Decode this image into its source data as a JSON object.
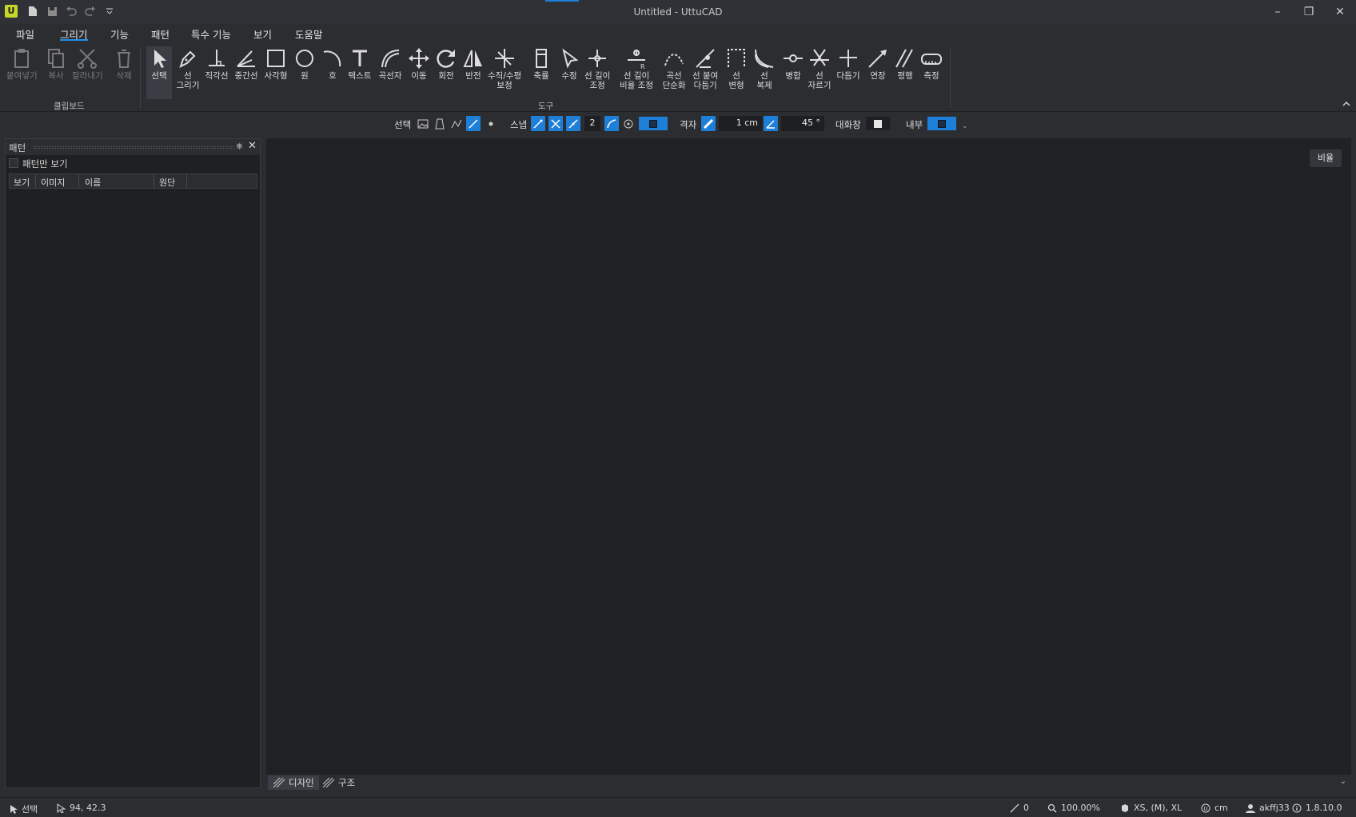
{
  "titlebar": {
    "title": "Untitled - UttuCAD",
    "logo": "U"
  },
  "menu": {
    "items": [
      "파일",
      "그리기",
      "기능",
      "패턴",
      "특수 기능",
      "보기",
      "도움말"
    ],
    "active": "그리기"
  },
  "ribbon": {
    "clipboard": {
      "paste": "붙여넣기",
      "copy": "복사",
      "cut": "잘라내기",
      "delete": "삭제",
      "group": "클립보드"
    },
    "tools": {
      "select": "선택",
      "draw_line": "선\n그리기",
      "perpendicular": "직각선",
      "midline": "중간선",
      "rectangle": "사각형",
      "circle": "원",
      "arc": "호",
      "text": "텍스트",
      "curve_ruler": "곡선자",
      "move": "이동",
      "rotate": "회전",
      "mirror": "반전",
      "vh_correct": "수직/수평\n보정",
      "shrink": "축률",
      "modify": "수정",
      "line_length": "선 길이\n조정",
      "line_length_ratio": "선 길이\n비율 조정",
      "curve_simplify": "곡선\n단순화",
      "line_attach": "선 붙여\n다듬기",
      "line_transform": "선\n변형",
      "line_copy": "선\n복제",
      "merge": "병합",
      "line_cut": "선\n자르기",
      "trim": "다듬기",
      "extend": "연장",
      "parallel": "평행",
      "measure": "측정",
      "group": "도구"
    }
  },
  "toolbar": {
    "select_label": "선택",
    "snap_label": "스냅",
    "snap_count": "2",
    "grid_label": "격자",
    "grid_size": "1 cm",
    "angle": "45 °",
    "dialog_label": "대화창",
    "inner_label": "내부"
  },
  "panel": {
    "title": "패턴",
    "pattern_only": "패턴만 보기",
    "columns": [
      "보기",
      "이미지",
      "이름",
      "원단"
    ]
  },
  "canvas": {
    "scale_button": "비율",
    "tabs": [
      "디자인",
      "구조"
    ]
  },
  "status": {
    "mode": "선택",
    "coords": "94, 42.3",
    "line_count": "0",
    "zoom": "100.00%",
    "sizes": "XS, (M), XL",
    "unit": "cm",
    "user": "akffj33",
    "version": "1.8.10.0"
  },
  "colors": {
    "accent": "#1e7fd9",
    "canvas": "#202122",
    "chrome": "#2b2d31"
  }
}
